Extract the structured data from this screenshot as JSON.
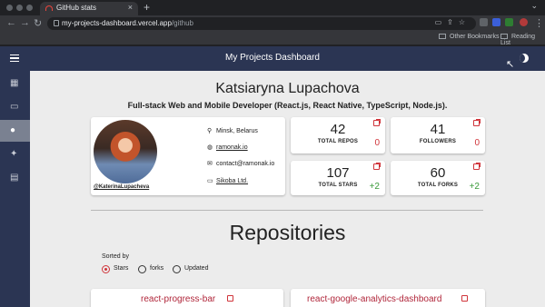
{
  "browser": {
    "tab_title": "GitHub stats",
    "tab_close": "×",
    "new_tab": "+",
    "url_host": "my-projects-dashboard.vercel.app",
    "url_path": "/github",
    "bookmarks": [
      "Other Bookmarks",
      "Reading List"
    ]
  },
  "app": {
    "title": "My Projects Dashboard"
  },
  "sidebar": {
    "items": [
      {
        "icon": "dashboard-icon"
      },
      {
        "icon": "devices-icon"
      },
      {
        "icon": "github-icon",
        "active": true
      },
      {
        "icon": "twitter-icon"
      },
      {
        "icon": "list-icon"
      }
    ]
  },
  "profile": {
    "name": "Katsiaryna Lupachova",
    "tagline": "Full-stack Web and Mobile Developer (React.js, React Native, TypeScript, Node.js).",
    "handle": "@KaterinaLupacheva",
    "location": "Minsk, Belarus",
    "website": "ramonak.io",
    "email": "contact@ramonak.io",
    "company": "Sikoba Ltd."
  },
  "stats": [
    {
      "value": "42",
      "label": "TOTAL REPOS",
      "delta": "0",
      "trend": "red"
    },
    {
      "value": "41",
      "label": "FOLLOWERS",
      "delta": "0",
      "trend": "red"
    },
    {
      "value": "107",
      "label": "TOTAL STARS",
      "delta": "+2",
      "trend": "green"
    },
    {
      "value": "60",
      "label": "TOTAL FORKS",
      "delta": "+2",
      "trend": "green"
    }
  ],
  "repositories": {
    "title": "Repositories",
    "sort_label": "Sorted by",
    "sort_options": [
      "Stars",
      "forks",
      "Updated"
    ],
    "selected": "Stars",
    "items": [
      "react-progress-bar",
      "react-google-analytics-dashboard"
    ]
  },
  "colors": {
    "appbar": "#2b3553",
    "accent": "#d0343a",
    "positive": "#3a9a3a"
  }
}
